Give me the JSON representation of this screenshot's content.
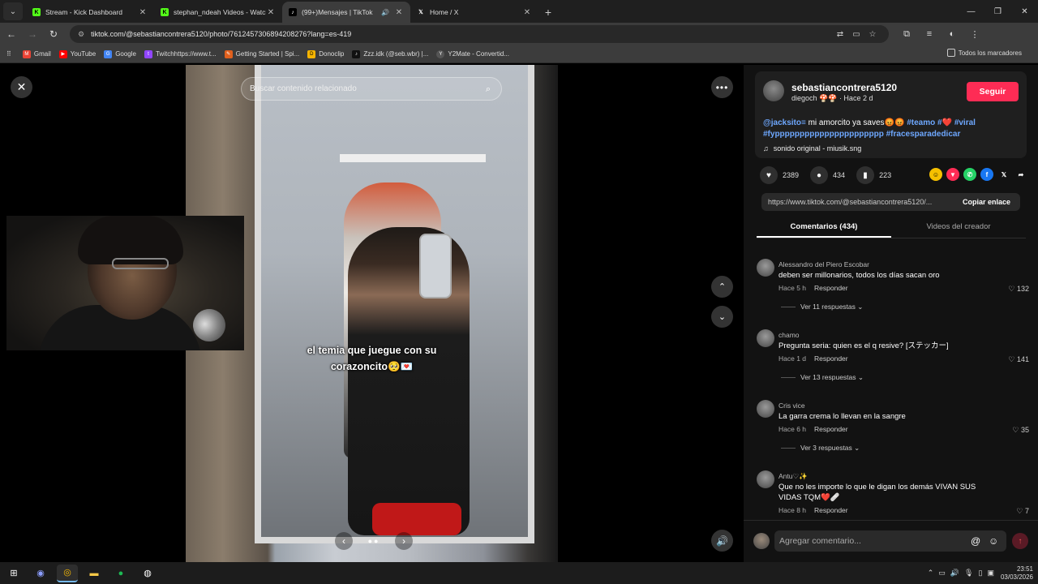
{
  "browser": {
    "tabs": [
      {
        "title": "Stream - Kick Dashboard",
        "favicon": "kick-icon",
        "color": "#53fc18"
      },
      {
        "title": "stephan_ndeah Videos - Watch",
        "favicon": "kick-icon",
        "color": "#53fc18"
      },
      {
        "title": "(99+)Mensajes | TikTok",
        "favicon": "tiktok-icon",
        "color": "#ffffff",
        "active": true
      },
      {
        "title": "Home / X",
        "favicon": "x-icon",
        "color": "#ffffff"
      }
    ],
    "url": "tiktok.com/@sebastiancontrera5120/photo/7612457306894208276?lang=es-419",
    "bookmarks": [
      {
        "label": "Gmail",
        "color": "#ea4335"
      },
      {
        "label": "YouTube",
        "color": "#ff0000"
      },
      {
        "label": "Google",
        "color": "#4285f4"
      },
      {
        "label": "Twitchhttps://www.t...",
        "color": "#9146ff"
      },
      {
        "label": "Getting Started | Spi...",
        "color": "#e0601d"
      },
      {
        "label": "Donoclip",
        "color": "#f5b400"
      },
      {
        "label": "Zzz.idk (@seb.wbr) |...",
        "color": "#111111"
      },
      {
        "label": "Y2Mate - Convertid...",
        "color": "#555555"
      }
    ],
    "all_bookmarks": "Todos los marcadores"
  },
  "viewer": {
    "search_placeholder": "Buscar contenido relacionado",
    "caption_line1": "el temia que juegue con su",
    "caption_line2": "corazoncito🥺💌"
  },
  "post": {
    "author": "sebastiancontrera5120",
    "author_sub": "diegoch 🍄🍄 · Hace 2 d",
    "follow_label": "Seguir",
    "mention": "@jacksito≡",
    "desc_text": " mi amorcito ya saves😡😡",
    "tags_line1": [
      "#teamo",
      "#❤️",
      "#viral"
    ],
    "tags_line2": [
      "#fypppppppppppppppppppppp",
      "#fracesparadedicar"
    ],
    "sound": "sonido original - miusik.sng",
    "likes": "2389",
    "comments": "434",
    "saves": "223",
    "link": "https://www.tiktok.com/@sebastiancontrera5120/...",
    "copy_label": "Copiar enlace"
  },
  "panel_tabs": {
    "comments": "Comentarios (434)",
    "creator": "Videos del creador"
  },
  "comments": [
    {
      "user": "Alessandro del Piero Escobar",
      "text": "deben ser millonarios, todos los días sacan oro",
      "time": "Hace 5 h",
      "reply": "Responder",
      "likes": "132",
      "replies": "Ver 11 respuestas"
    },
    {
      "user": "chamo",
      "text": "Pregunta seria: quien es el q resive? [ステッカー]",
      "time": "Hace 1 d",
      "reply": "Responder",
      "likes": "141",
      "replies": "Ver 13 respuestas"
    },
    {
      "user": "Cris vice",
      "text": "La garra crema lo llevan en la sangre",
      "time": "Hace 6 h",
      "reply": "Responder",
      "likes": "35",
      "replies": "Ver 3 respuestas"
    },
    {
      "user": "Antu♡✨",
      "text": "Que no les importe lo que le digan los demás VIVAN SUS VIDAS TQM❤️🩹",
      "time": "Hace 8 h",
      "reply": "Responder",
      "likes": "7",
      "replies": ""
    }
  ],
  "composer": {
    "placeholder": "Agregar comentario..."
  },
  "taskbar": {
    "time": "23:51",
    "date": "03/03/2026"
  },
  "colors": {
    "follow": "#fe2c55",
    "hashtag": "#6ea8ff"
  }
}
